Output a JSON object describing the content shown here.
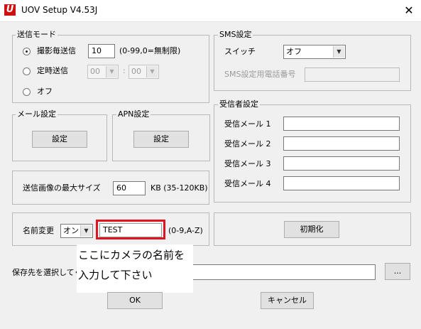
{
  "window": {
    "title": "UOV Setup V4.53J",
    "icon": "uov-app-icon",
    "icon_letter": "U",
    "close": "✕"
  },
  "send_mode": {
    "legend": "送信モード",
    "per_shot": {
      "label": "撮影毎送信",
      "value": "10",
      "hint": "(0-99,0=無制限)",
      "selected": true
    },
    "scheduled": {
      "label": "定時送信",
      "hour": "00",
      "separator": ":",
      "minute": "00",
      "selected": false
    },
    "off": {
      "label": "オフ",
      "selected": false
    }
  },
  "sms": {
    "legend": "SMS設定",
    "switch_label": "スイッチ",
    "switch_value": "オフ",
    "phone_label": "SMS設定用電話番号",
    "phone_value": ""
  },
  "mail": {
    "legend": "メール設定",
    "button": "設定"
  },
  "apn": {
    "legend": "APN設定",
    "button": "設定"
  },
  "image_size": {
    "label": "送信画像の最大サイズ",
    "value": "60",
    "unit": "KB (35-120KB)"
  },
  "recipients": {
    "legend": "受信者設定",
    "items": [
      {
        "label": "受信メール 1",
        "value": ""
      },
      {
        "label": "受信メール 2",
        "value": ""
      },
      {
        "label": "受信メール 3",
        "value": ""
      },
      {
        "label": "受信メール 4",
        "value": ""
      }
    ]
  },
  "rename": {
    "label": "名前変更",
    "toggle_value": "オン",
    "name_value": "TEST",
    "hint": "(0-9,A-Z)"
  },
  "reset_button": "初期化",
  "save_location": {
    "label": "保存先を選択してく",
    "path": "",
    "browse": "..."
  },
  "overlay_hint": {
    "line1": "ここにカメラの名前を",
    "line2": "入力して下さい"
  },
  "buttons": {
    "ok": "OK",
    "cancel": "キャンセル"
  },
  "colors": {
    "highlight_border": "#e0141e",
    "app_icon": "#d01010"
  }
}
